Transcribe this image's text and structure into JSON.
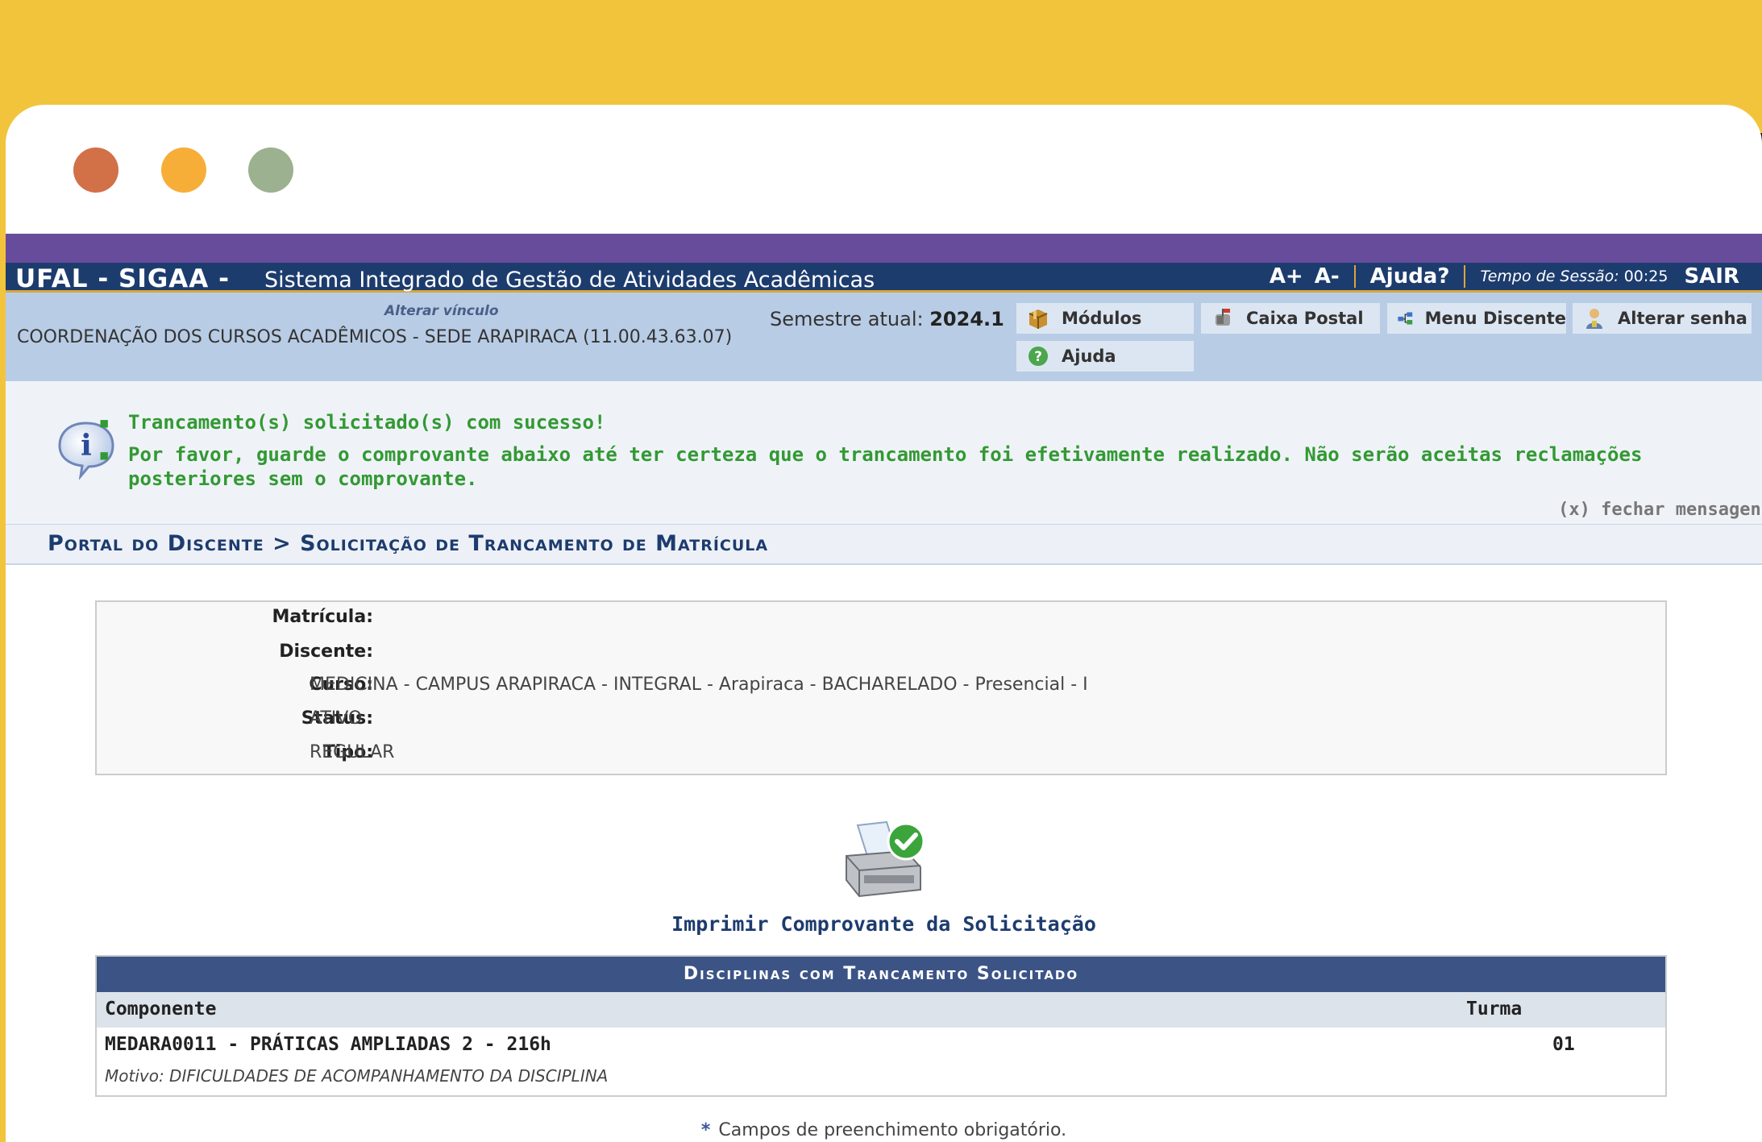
{
  "header": {
    "system": "UFAL - SIGAA -",
    "system_name": "Sistema Integrado de Gestão de Atividades Acadêmicas",
    "font_increase": "A+",
    "font_decrease": "A-",
    "help": "Ajuda?",
    "session_label": "Tempo de Sessão:",
    "session_time": "00:25",
    "logout": "SAIR"
  },
  "infobar": {
    "change_link": "Alterar vínculo",
    "unit": "COORDENAÇÃO DOS CURSOS ACADÊMICOS - SEDE ARAPIRACA (11.00.43.63.07)",
    "semester_label": "Semestre atual:",
    "semester_value": "2024.1",
    "menu": {
      "modules": "Módulos",
      "mailbox": "Caixa Postal",
      "student_menu": "Menu Discente",
      "change_password": "Alterar senha",
      "help": "Ajuda"
    }
  },
  "messages": [
    "Trancamento(s) solicitado(s) com sucesso!",
    "Por favor, guarde o comprovante abaixo até ter certeza que o trancamento foi efetivamente realizado. Não serão aceitas reclamações posteriores sem o comprovante."
  ],
  "close_messages": "(x) fechar mensagens",
  "breadcrumb": "Portal do Discente > Solicitação de Trancamento de Matrícula",
  "student": {
    "matricula_label": "Matrícula:",
    "matricula_value": "",
    "discente_label": "Discente:",
    "discente_value": "",
    "curso_label": "Curso:",
    "curso_value": "MEDICINA - CAMPUS ARAPIRACA - INTEGRAL - Arapiraca - BACHARELADO - Presencial - I",
    "status_label": "Status:",
    "status_value": "ATIVO",
    "tipo_label": "Tipo:",
    "tipo_value": "REGULAR"
  },
  "print_link": "Imprimir Comprovante da Solicitação",
  "table": {
    "caption": "Disciplinas com Trancamento Solicitado",
    "col_component": "Componente",
    "col_class": "Turma",
    "rows": [
      {
        "component": "MEDARA0011 - PRÁTICAS AMPLIADAS 2 - 216h",
        "class": "01",
        "reason": "Motivo: DIFICULDADES DE ACOMPANHAMENTO DA DISCIPLINA"
      }
    ]
  },
  "required_note": "Campos de preenchimento obrigatório.",
  "colors": {
    "background": "#F2C43C",
    "header_navy": "#1D3C6E",
    "purple_strip": "#674C9C",
    "infobar_blue": "#B8CCE5",
    "success_green": "#339933"
  }
}
